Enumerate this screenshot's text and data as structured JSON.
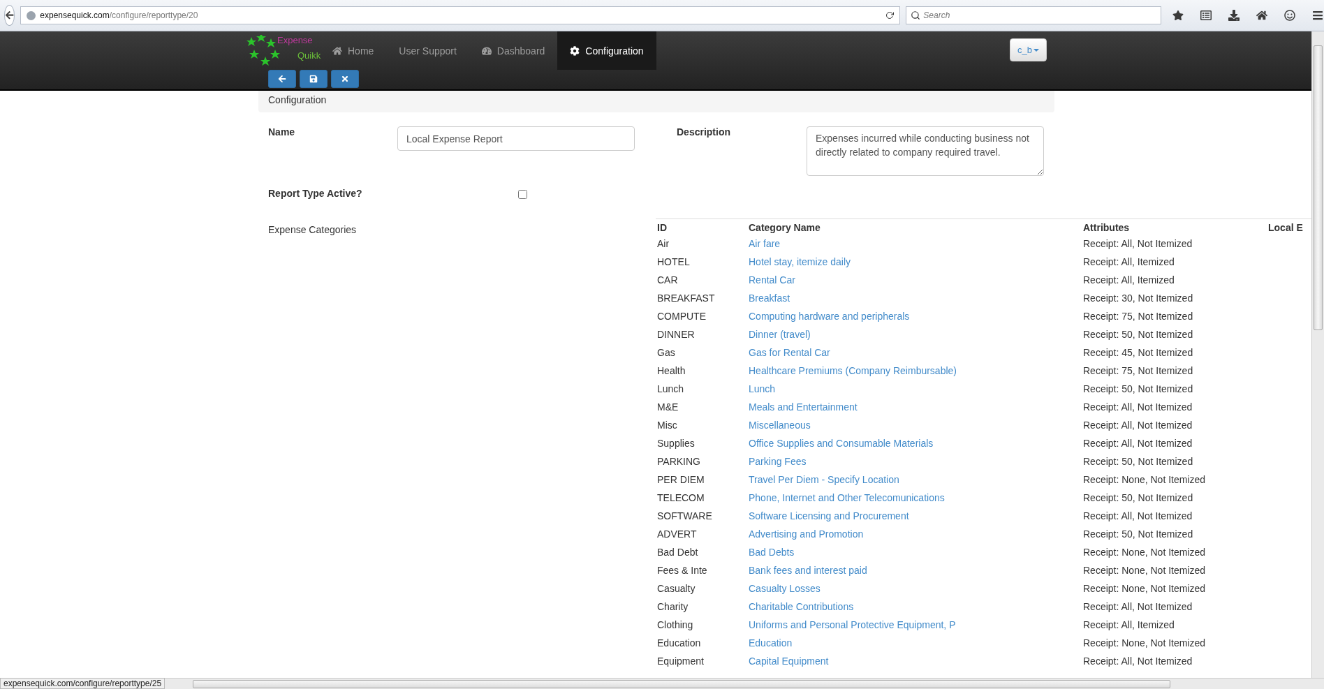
{
  "browser": {
    "url_domain": "expensequick.com",
    "url_path": "/configure/reporttype/20",
    "search_placeholder": "Search",
    "status_url": "expensequick.com/configure/reporttype/25"
  },
  "nav": {
    "logo_top": "Expense",
    "logo_bottom": "Quikk",
    "items": [
      {
        "kind": "home",
        "label": "Home",
        "selected": false
      },
      {
        "kind": "plain",
        "label": "User Support",
        "selected": false
      },
      {
        "kind": "dashboard",
        "label": "Dashboard",
        "selected": false
      },
      {
        "kind": "gear",
        "label": "Configuration",
        "selected": true
      }
    ],
    "user_button": "c_b"
  },
  "toolbar": [
    {
      "kind": "back"
    },
    {
      "kind": "save"
    },
    {
      "kind": "close"
    }
  ],
  "breadcrumb": "Configuration",
  "form": {
    "name_label": "Name",
    "name_value": "Local Expense Report",
    "description_label": "Description",
    "description_value": "Expenses incurred while conducting business not directly related to company required travel.",
    "active_label": "Report Type Active?",
    "active_checked": false,
    "categories_label": "Expense Categories"
  },
  "table": {
    "columns": [
      "ID",
      "Category Name",
      "Attributes",
      "Local E"
    ],
    "rows": [
      {
        "id": "Air",
        "name": "Air fare",
        "attributes": "Receipt: All, Not Itemized"
      },
      {
        "id": "HOTEL",
        "name": "Hotel stay, itemize daily",
        "attributes": "Receipt: All, Itemized"
      },
      {
        "id": "CAR",
        "name": "Rental Car",
        "attributes": "Receipt: All, Itemized"
      },
      {
        "id": "BREAKFAST",
        "name": "Breakfast",
        "attributes": "Receipt: 30, Not Itemized"
      },
      {
        "id": "COMPUTE",
        "name": "Computing hardware and peripherals",
        "attributes": "Receipt: 75, Not Itemized"
      },
      {
        "id": "DINNER",
        "name": "Dinner (travel)",
        "attributes": "Receipt: 50, Not Itemized"
      },
      {
        "id": "Gas",
        "name": "Gas for Rental Car",
        "attributes": "Receipt: 45, Not Itemized"
      },
      {
        "id": "Health",
        "name": "Healthcare Premiums (Company Reimbursable)",
        "attributes": "Receipt: 75, Not Itemized"
      },
      {
        "id": "Lunch",
        "name": "Lunch",
        "attributes": "Receipt: 50, Not Itemized"
      },
      {
        "id": "M&E",
        "name": "Meals and Entertainment",
        "attributes": "Receipt: All, Not Itemized"
      },
      {
        "id": "Misc",
        "name": "Miscellaneous",
        "attributes": "Receipt: All, Not Itemized"
      },
      {
        "id": "Supplies",
        "name": "Office Supplies and Consumable Materials",
        "attributes": "Receipt: All, Not Itemized"
      },
      {
        "id": "PARKING",
        "name": "Parking Fees",
        "attributes": "Receipt: 50, Not Itemized"
      },
      {
        "id": "PER DIEM",
        "name": "Travel Per Diem - Specify Location",
        "attributes": "Receipt: None, Not Itemized"
      },
      {
        "id": "TELECOM",
        "name": "Phone, Internet and Other Telecomunications",
        "attributes": "Receipt: 50, Not Itemized"
      },
      {
        "id": "SOFTWARE",
        "name": "Software Licensing and Procurement",
        "attributes": "Receipt: All, Not Itemized"
      },
      {
        "id": "ADVERT",
        "name": "Advertising and Promotion",
        "attributes": "Receipt: 50, Not Itemized"
      },
      {
        "id": "Bad Debt",
        "name": "Bad Debts",
        "attributes": "Receipt: None, Not Itemized"
      },
      {
        "id": "Fees & Inte",
        "name": "Bank fees and interest paid",
        "attributes": "Receipt: None, Not Itemized"
      },
      {
        "id": "Casualty",
        "name": "Casualty Losses",
        "attributes": "Receipt: None, Not Itemized"
      },
      {
        "id": "Charity",
        "name": "Charitable Contributions",
        "attributes": "Receipt: All, Not Itemized"
      },
      {
        "id": "Clothing",
        "name": "Uniforms and Personal Protective Equipment, P",
        "attributes": "Receipt: All, Itemized"
      },
      {
        "id": "Education",
        "name": "Education",
        "attributes": "Receipt: None, Not Itemized"
      },
      {
        "id": "Equipment",
        "name": "Capital Equipment",
        "attributes": "Receipt: All, Not Itemized"
      }
    ]
  }
}
